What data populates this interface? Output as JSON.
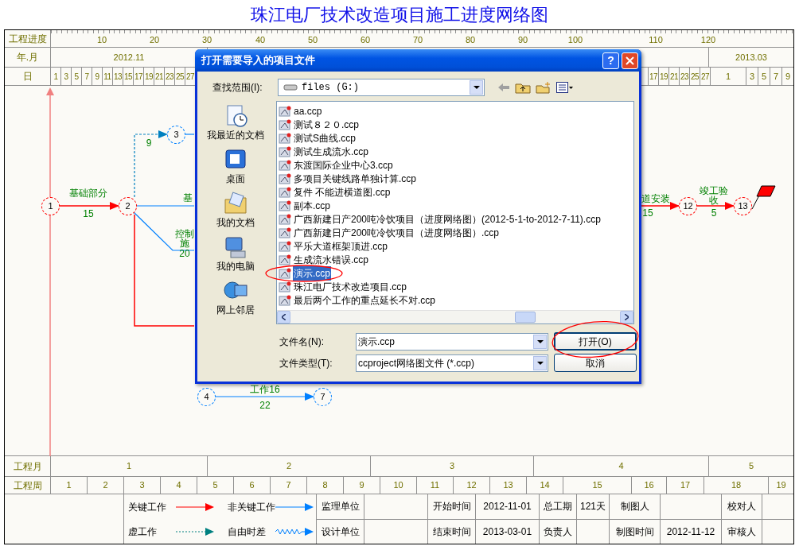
{
  "title": "珠江电厂技术改造项目施工进度网络图",
  "timescale": {
    "progress_label": "工程进度",
    "progress_ticks": [
      "10",
      "20",
      "30",
      "40",
      "50",
      "60",
      "70",
      "80",
      "90",
      "100",
      "110",
      "120"
    ],
    "month_label": "年.月",
    "months": [
      "2012.11",
      "2013.03"
    ],
    "day_label": "日",
    "days_nov": [
      "1",
      "3",
      "5",
      "7",
      "9",
      "11",
      "13",
      "15",
      "17",
      "19",
      "21",
      "23",
      "25",
      "27"
    ],
    "days_dec": [
      "17",
      "19",
      "21",
      "23",
      "25",
      "27"
    ],
    "days_mar": [
      "1",
      "3",
      "5",
      "7",
      "9"
    ]
  },
  "network": {
    "nodes": [
      {
        "label": "1",
        "kind": "critical"
      },
      {
        "label": "2",
        "kind": "critical"
      },
      {
        "label": "3",
        "kind": "noncritical"
      },
      {
        "label": "4",
        "kind": "noncritical"
      },
      {
        "label": "7",
        "kind": "noncritical"
      },
      {
        "label": "12",
        "kind": "critical"
      },
      {
        "label": "13",
        "kind": "critical"
      }
    ],
    "activities": [
      {
        "name": "基础部分",
        "duration": "15",
        "kind": "critical"
      },
      {
        "duration": "9",
        "kind": "dummy"
      },
      {
        "name": "基",
        "kind": "noncritical"
      },
      {
        "name": "控制施",
        "duration": "20",
        "kind": "noncritical"
      },
      {
        "name": "工作16",
        "duration": "22",
        "kind": "noncritical"
      },
      {
        "name": "道安装",
        "duration": "15",
        "kind": "critical"
      },
      {
        "name": "竣工验收",
        "duration": "5",
        "kind": "critical"
      }
    ]
  },
  "dialog": {
    "title": "打开需要导入的项目文件",
    "help_button": "?",
    "look_in_label": "查找范围(I):",
    "look_in": "files (G:)",
    "places": [
      "我最近的文档",
      "桌面",
      "我的文档",
      "我的电脑",
      "网上邻居"
    ],
    "files": [
      {
        "name": "aa.ccp",
        "selected": false
      },
      {
        "name": "测试８２０.ccp",
        "selected": false
      },
      {
        "name": "测试S曲线.ccp",
        "selected": false
      },
      {
        "name": "测试生成流水.ccp",
        "selected": false
      },
      {
        "name": "东渡国际企业中心3.ccp",
        "selected": false
      },
      {
        "name": "多项目关键线路单独计算.ccp",
        "selected": false
      },
      {
        "name": "复件 不能进横道图.ccp",
        "selected": false
      },
      {
        "name": "副本.ccp",
        "selected": false
      },
      {
        "name": "广西新建日产200吨冷饮项目（进度网络图）(2012-5-1-to-2012-7-11).ccp",
        "selected": false
      },
      {
        "name": "广西新建日产200吨冷饮项目（进度网络图）.ccp",
        "selected": false
      },
      {
        "name": "平乐大道框架顶进.ccp",
        "selected": false
      },
      {
        "name": "生成流水错误.ccp",
        "selected": false
      },
      {
        "name": "演示.ccp",
        "selected": true
      },
      {
        "name": "珠江电厂技术改造项目.ccp",
        "selected": false
      },
      {
        "name": "最后两个工作的重点延长不对.ccp",
        "selected": false
      }
    ],
    "filename_label": "文件名(N):",
    "filename": "演示.ccp",
    "filetype_label": "文件类型(T):",
    "filetype": "ccproject网络图文件 (*.ccp)",
    "buttons": [
      "打开(O)",
      "取消"
    ]
  },
  "footer": {
    "month_label": "工程月",
    "months": [
      "1",
      "2",
      "3",
      "4",
      "5"
    ],
    "week_label": "工程周",
    "weeks": [
      "1",
      "2",
      "3",
      "4",
      "5",
      "6",
      "7",
      "8",
      "9",
      "10",
      "11",
      "12",
      "13",
      "14",
      "15",
      "16",
      "17",
      "18",
      "19"
    ],
    "legend": [
      {
        "label": "关键工作",
        "kind": "critical"
      },
      {
        "label": "非关键工作",
        "kind": "noncritical"
      },
      {
        "label": "虚工作",
        "kind": "dummy"
      },
      {
        "label": "自由时差",
        "kind": "float"
      }
    ],
    "info": [
      [
        {
          "label": "监理单位"
        },
        {
          "label": "开始时间",
          "value": "2012-11-01"
        },
        {
          "label": "总工期",
          "value": "121天"
        },
        {
          "label": "制图人"
        },
        {
          "label": "校对人"
        }
      ],
      [
        {
          "label": "设计单位"
        },
        {
          "label": "结束时间",
          "value": "2013-03-01"
        },
        {
          "label": "负责人"
        },
        {
          "label": "制图时间",
          "value": "2012-11-12"
        },
        {
          "label": "审核人"
        }
      ]
    ]
  }
}
